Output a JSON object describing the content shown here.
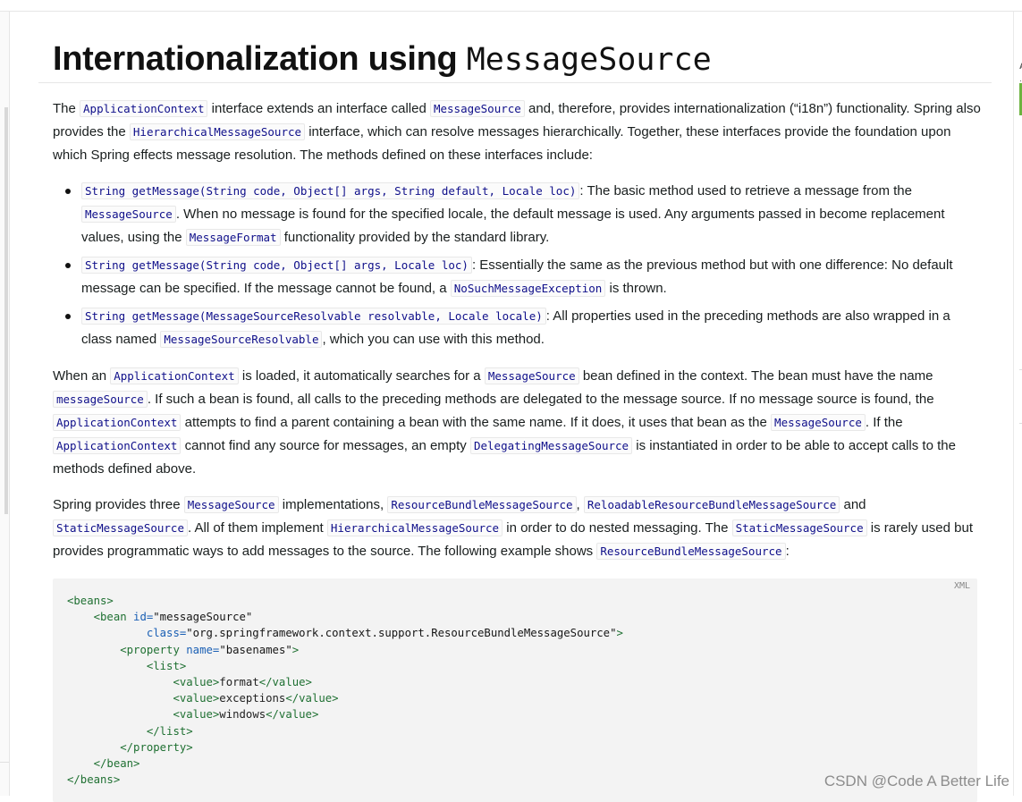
{
  "heading": {
    "text": "Internationalization using ",
    "code": "MessageSource"
  },
  "para1": {
    "t1": "The ",
    "c1": "ApplicationContext",
    "t2": " interface extends an interface called ",
    "c2": "MessageSource",
    "t3": " and, therefore, provides internationalization (“i18n”) functionality. Spring also provides the ",
    "c3": "HierarchicalMessageSource",
    "t4": " interface, which can resolve messages hierarchically. Together, these interfaces provide the foundation upon which Spring effects message resolution. The methods defined on these interfaces include:"
  },
  "bullets": [
    {
      "c1": "String getMessage(String code, Object[] args, String default, Locale loc)",
      "t1": ": The basic method used to retrieve a message from the ",
      "c2": "MessageSource",
      "t2": ". When no message is found for the specified locale, the default message is used. Any arguments passed in become replacement values, using the ",
      "c3": "MessageFormat",
      "t3": " functionality provided by the standard library."
    },
    {
      "c1": "String getMessage(String code, Object[] args, Locale loc)",
      "t1": ": Essentially the same as the previous method but with one difference: No default message can be specified. If the message cannot be found, a ",
      "c2": "NoSuchMessageException",
      "t2": " is thrown."
    },
    {
      "c1": "String getMessage(MessageSourceResolvable resolvable, Locale locale)",
      "t1": ": All properties used in the preceding methods are also wrapped in a class named ",
      "c2": "MessageSourceResolvable",
      "t2": ", which you can use with this method."
    }
  ],
  "para2": {
    "t1": "When an ",
    "c1": "ApplicationContext",
    "t2": " is loaded, it automatically searches for a ",
    "c2": "MessageSource",
    "t3": " bean defined in the context. The bean must have the name ",
    "c3": "messageSource",
    "t4": ". If such a bean is found, all calls to the preceding methods are delegated to the message source. If no message source is found, the ",
    "c4": "ApplicationContext",
    "t5": " attempts to find a parent containing a bean with the same name. If it does, it uses that bean as the ",
    "c5": "MessageSource",
    "t6": ". If the ",
    "c6": "ApplicationContext",
    "t7": " cannot find any source for messages, an empty ",
    "c7": "DelegatingMessageSource",
    "t8": " is instantiated in order to be able to accept calls to the methods defined above."
  },
  "para3": {
    "t1": "Spring provides three ",
    "c1": "MessageSource",
    "t2": " implementations, ",
    "c2": "ResourceBundleMessageSource",
    "t3": ", ",
    "c3": "ReloadableResourceBundleMessageSource",
    "t4": " and ",
    "c4": "StaticMessageSource",
    "t5": ". All of them implement ",
    "c5": "HierarchicalMessageSource",
    "t6": " in order to do nested messaging. The ",
    "c6": "StaticMessageSource",
    "t7": " is rarely used but provides programmatic ways to add messages to the source. The following example shows ",
    "c7": "ResourceBundleMessageSource",
    "t8": ":"
  },
  "codeblock": {
    "lang": "XML",
    "lines": [
      [
        {
          "k": "tg",
          "v": "<beans>"
        }
      ],
      [
        {
          "k": "tx",
          "v": "    "
        },
        {
          "k": "tg",
          "v": "<bean "
        },
        {
          "k": "at",
          "v": "id="
        },
        {
          "k": "st",
          "v": "\"messageSource\""
        }
      ],
      [
        {
          "k": "tx",
          "v": "            "
        },
        {
          "k": "at",
          "v": "class="
        },
        {
          "k": "st",
          "v": "\"org.springframework.context.support.ResourceBundleMessageSource\""
        },
        {
          "k": "tg",
          "v": ">"
        }
      ],
      [
        {
          "k": "tx",
          "v": "        "
        },
        {
          "k": "tg",
          "v": "<property "
        },
        {
          "k": "at",
          "v": "name="
        },
        {
          "k": "st",
          "v": "\"basenames\""
        },
        {
          "k": "tg",
          "v": ">"
        }
      ],
      [
        {
          "k": "tx",
          "v": "            "
        },
        {
          "k": "tg",
          "v": "<list>"
        }
      ],
      [
        {
          "k": "tx",
          "v": "                "
        },
        {
          "k": "tg",
          "v": "<value>"
        },
        {
          "k": "tx",
          "v": "format"
        },
        {
          "k": "tg",
          "v": "</value>"
        }
      ],
      [
        {
          "k": "tx",
          "v": "                "
        },
        {
          "k": "tg",
          "v": "<value>"
        },
        {
          "k": "tx",
          "v": "exceptions"
        },
        {
          "k": "tg",
          "v": "</value>"
        }
      ],
      [
        {
          "k": "tx",
          "v": "                "
        },
        {
          "k": "tg",
          "v": "<value>"
        },
        {
          "k": "tx",
          "v": "windows"
        },
        {
          "k": "tg",
          "v": "</value>"
        }
      ],
      [
        {
          "k": "tx",
          "v": "            "
        },
        {
          "k": "tg",
          "v": "</list>"
        }
      ],
      [
        {
          "k": "tx",
          "v": "        "
        },
        {
          "k": "tg",
          "v": "</property>"
        }
      ],
      [
        {
          "k": "tx",
          "v": "    "
        },
        {
          "k": "tg",
          "v": "</bean>"
        }
      ],
      [
        {
          "k": "tg",
          "v": "</beans>"
        }
      ]
    ]
  },
  "right_panel": {
    "letter": "A",
    "dot": "·"
  },
  "watermark": "CSDN @Code A Better Life"
}
